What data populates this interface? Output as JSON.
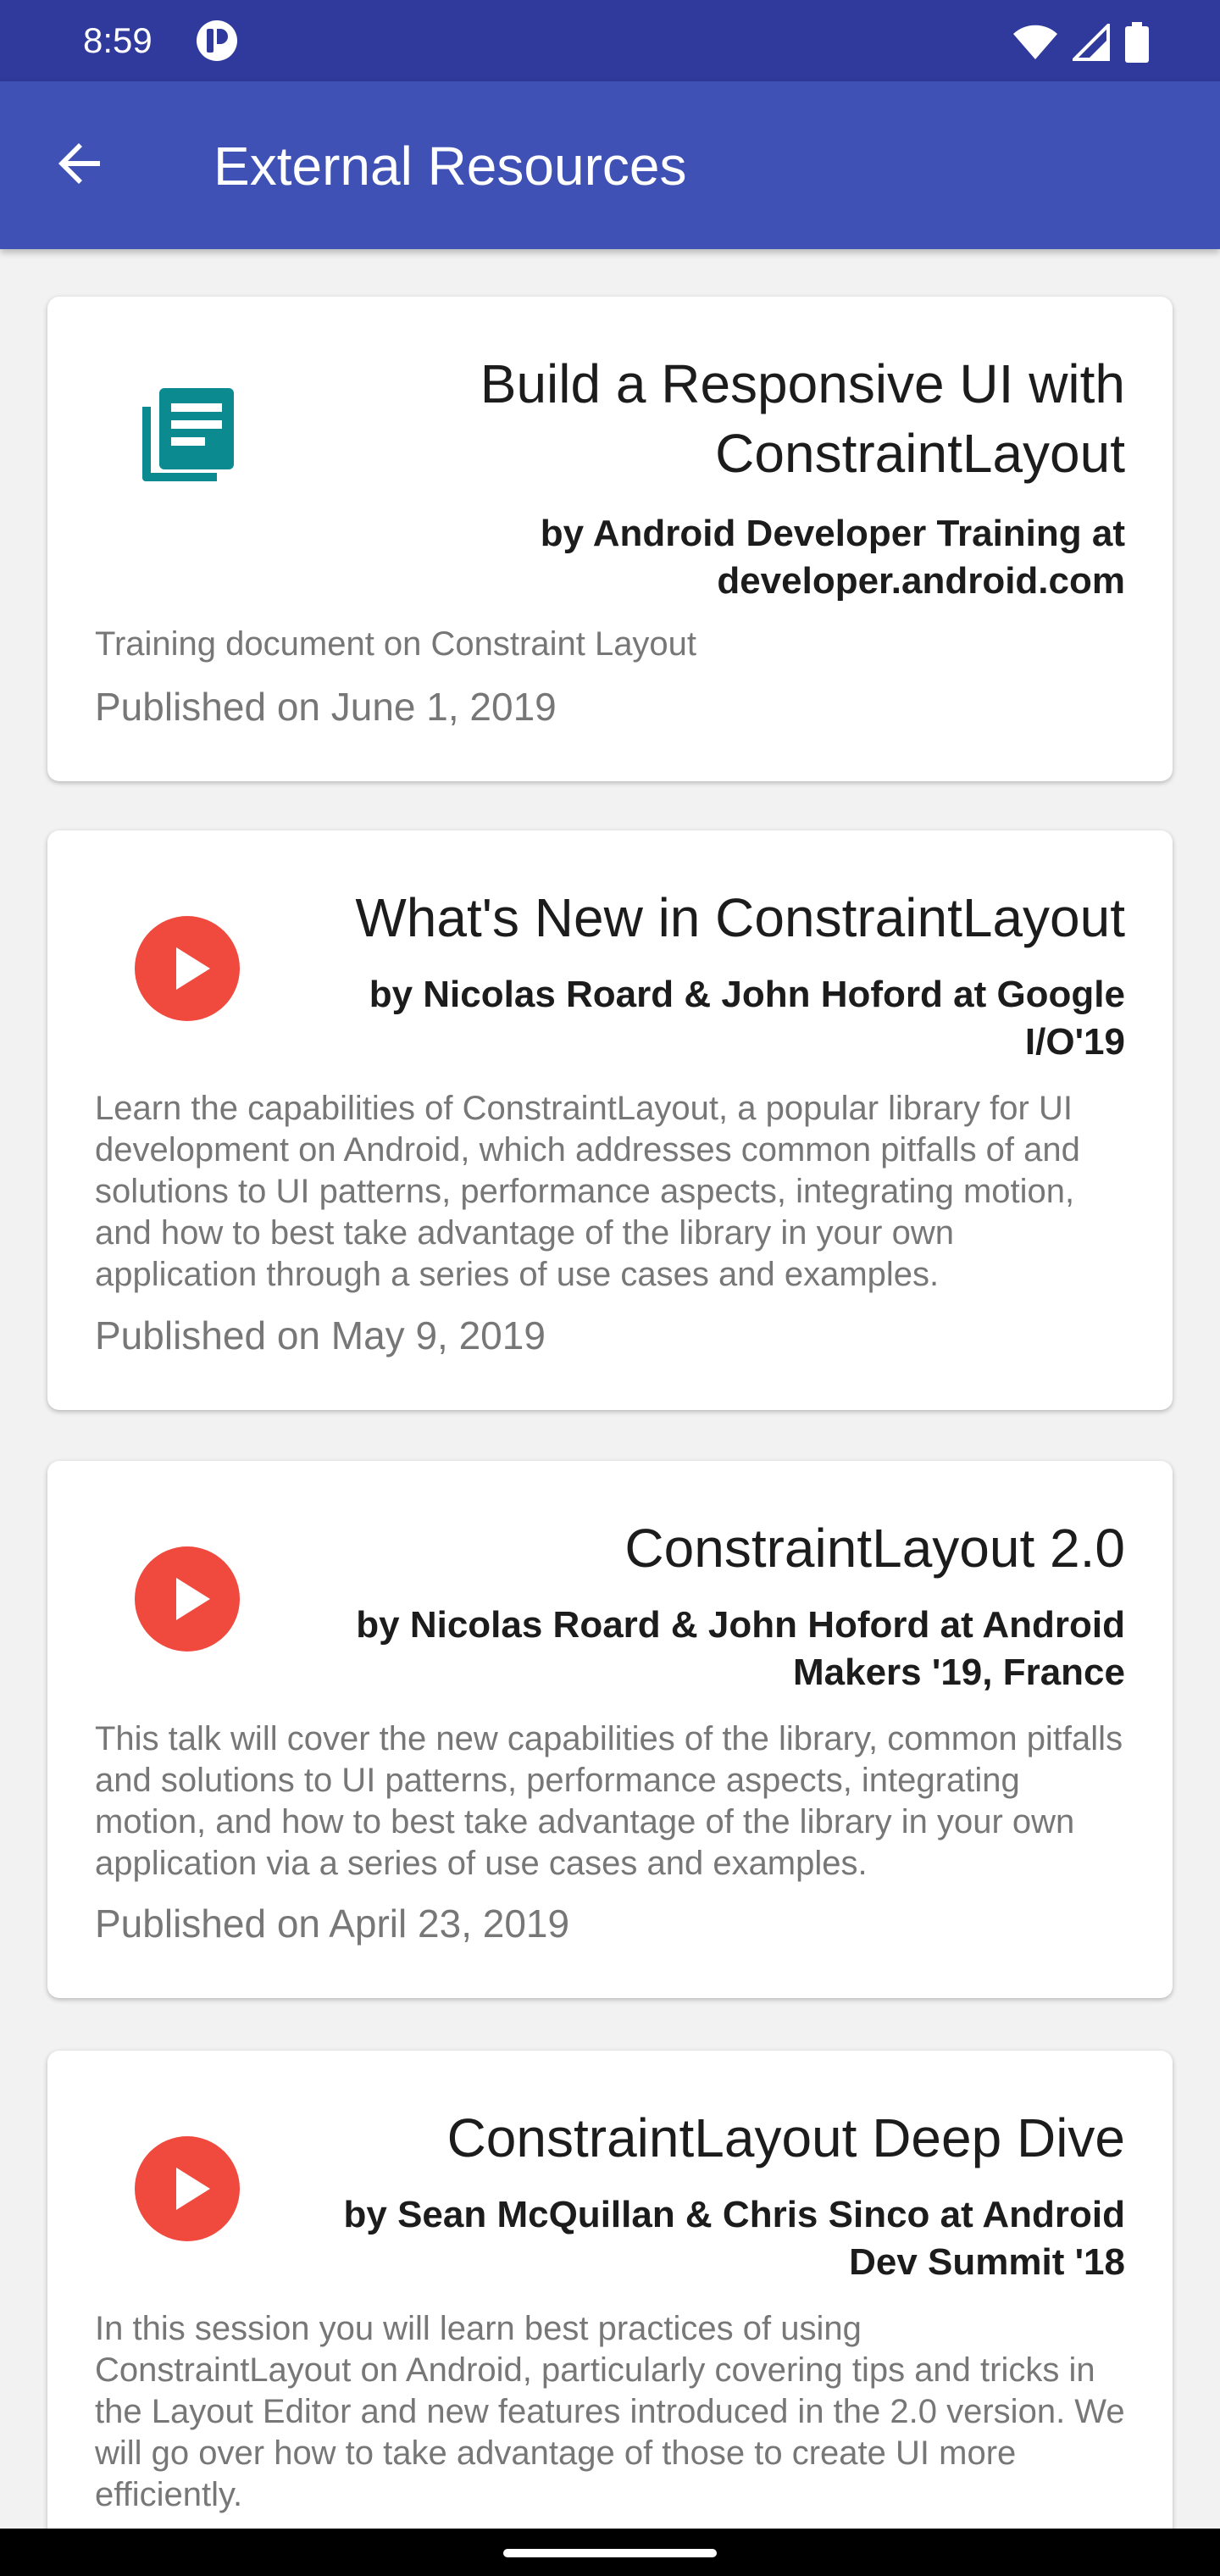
{
  "status_bar": {
    "time": "8:59",
    "notification_icon": "app-notification-icon",
    "icons": [
      "wifi-icon",
      "signal-icon",
      "battery-icon"
    ]
  },
  "app_bar": {
    "title": "External Resources",
    "back_icon": "arrow-back-icon",
    "background_color": "#3f51b5"
  },
  "resources": [
    {
      "icon": "article-icon",
      "icon_color": "#008080",
      "title": "Build a Responsive UI with ConstraintLayout",
      "author": "by Android Developer Training at developer.android.com",
      "description": "Training document on Constraint Layout",
      "date": "Published on June 1, 2019"
    },
    {
      "icon": "play-icon",
      "icon_color": "#f44336",
      "title": "What's New in ConstraintLayout",
      "author": "by Nicolas Roard & John Hoford at Google I/O'19",
      "description": "Learn the capabilities of ConstraintLayout, a popular library for UI development on Android, which addresses common pitfalls of and solutions to UI patterns, performance aspects, integrating motion, and how to best take advantage of the library in your own application through a series of use cases and examples.",
      "date": "Published on May 9, 2019"
    },
    {
      "icon": "play-icon",
      "icon_color": "#f44336",
      "title": "ConstraintLayout 2.0",
      "author": "by Nicolas Roard & John Hoford at Android Makers '19, France",
      "description": "This talk will cover the new capabilities of the library, common pitfalls and solutions to UI patterns, performance aspects, integrating motion, and how to best take advantage of the library in your own application via a series of use cases and examples.",
      "date": "Published on April 23, 2019"
    },
    {
      "icon": "play-icon",
      "icon_color": "#f44336",
      "title": "ConstraintLayout Deep Dive",
      "author": "by Sean McQuillan & Chris Sinco at Android Dev Summit '18",
      "description": "In this session you will learn best practices of using ConstraintLayout on Android, particularly covering tips and tricks in the Layout Editor and new features introduced in the 2.0 version. We will go over how to take advantage of those to create UI more efficiently.",
      "date": ""
    }
  ]
}
